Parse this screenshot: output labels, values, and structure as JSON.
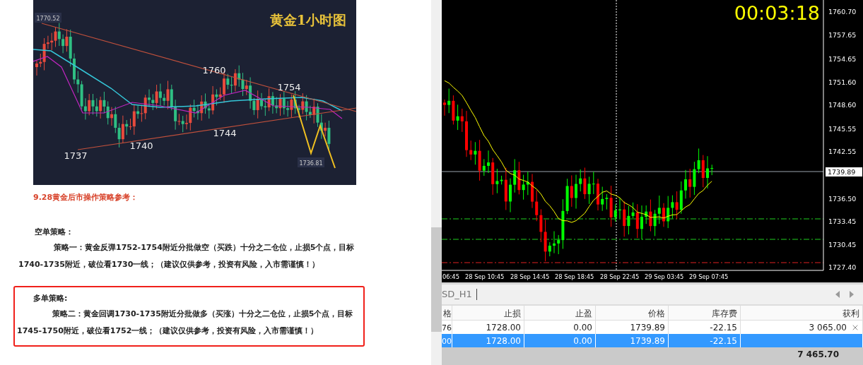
{
  "article": {
    "chart_image": {
      "title": "黄金1小时图",
      "price_tags": [
        "1770.52",
        "1736.81"
      ],
      "level_labels": [
        "1760",
        "1754",
        "1744",
        "1740",
        "1737"
      ]
    },
    "heading": "9.28黄金后市操作策略参考：",
    "sections": [
      {
        "title": "空单策略：",
        "text": "策略一：黄金反弹1752-1754附近分批做空（买跌）十分之二仓位，止损5个点，目标1740-1735附近，破位看1730一线；（建议仅供参考，投资有风险，入市需谨慎！）",
        "highlighted": false
      },
      {
        "title": "多单策略:",
        "text": "策略二：黄金回调1730-1735附近分批做多（买涨）十分之二仓位，止损5个点，目标1745-1750附近，破位看1752一线；（建议仅供参考，投资有风险，入市需谨慎！）",
        "highlighted": true
      }
    ]
  },
  "chart": {
    "timer": "00:03:18",
    "price_axis": [
      "1760.70",
      "1757.65",
      "1754.65",
      "1751.60",
      "1748.60",
      "1745.55",
      "1742.55",
      "1736.50",
      "1733.45",
      "1730.45",
      "1727.40"
    ],
    "current_price": "1739.89",
    "time_axis": [
      "06:45",
      "28 Sep 10:45",
      "28 Sep 14:45",
      "28 Sep 18:45",
      "28 Sep 22:45",
      "29 Sep 03:45",
      "29 Sep 07:45"
    ]
  },
  "tab": {
    "label": "SD_H1"
  },
  "table": {
    "columns": [
      "格",
      "止损",
      "止盈",
      "价格",
      "库存费",
      "获利"
    ],
    "rows": [
      {
        "cells": [
          "76",
          "1728.00",
          "0.00",
          "1739.89",
          "-22.15",
          "3 065.00"
        ],
        "selected": false,
        "closable": true
      },
      {
        "cells": [
          "00",
          "1728.00",
          "0.00",
          "1739.89",
          "-22.15"
        ],
        "selected": true,
        "closable": false
      }
    ],
    "total": "7 465.70"
  }
}
